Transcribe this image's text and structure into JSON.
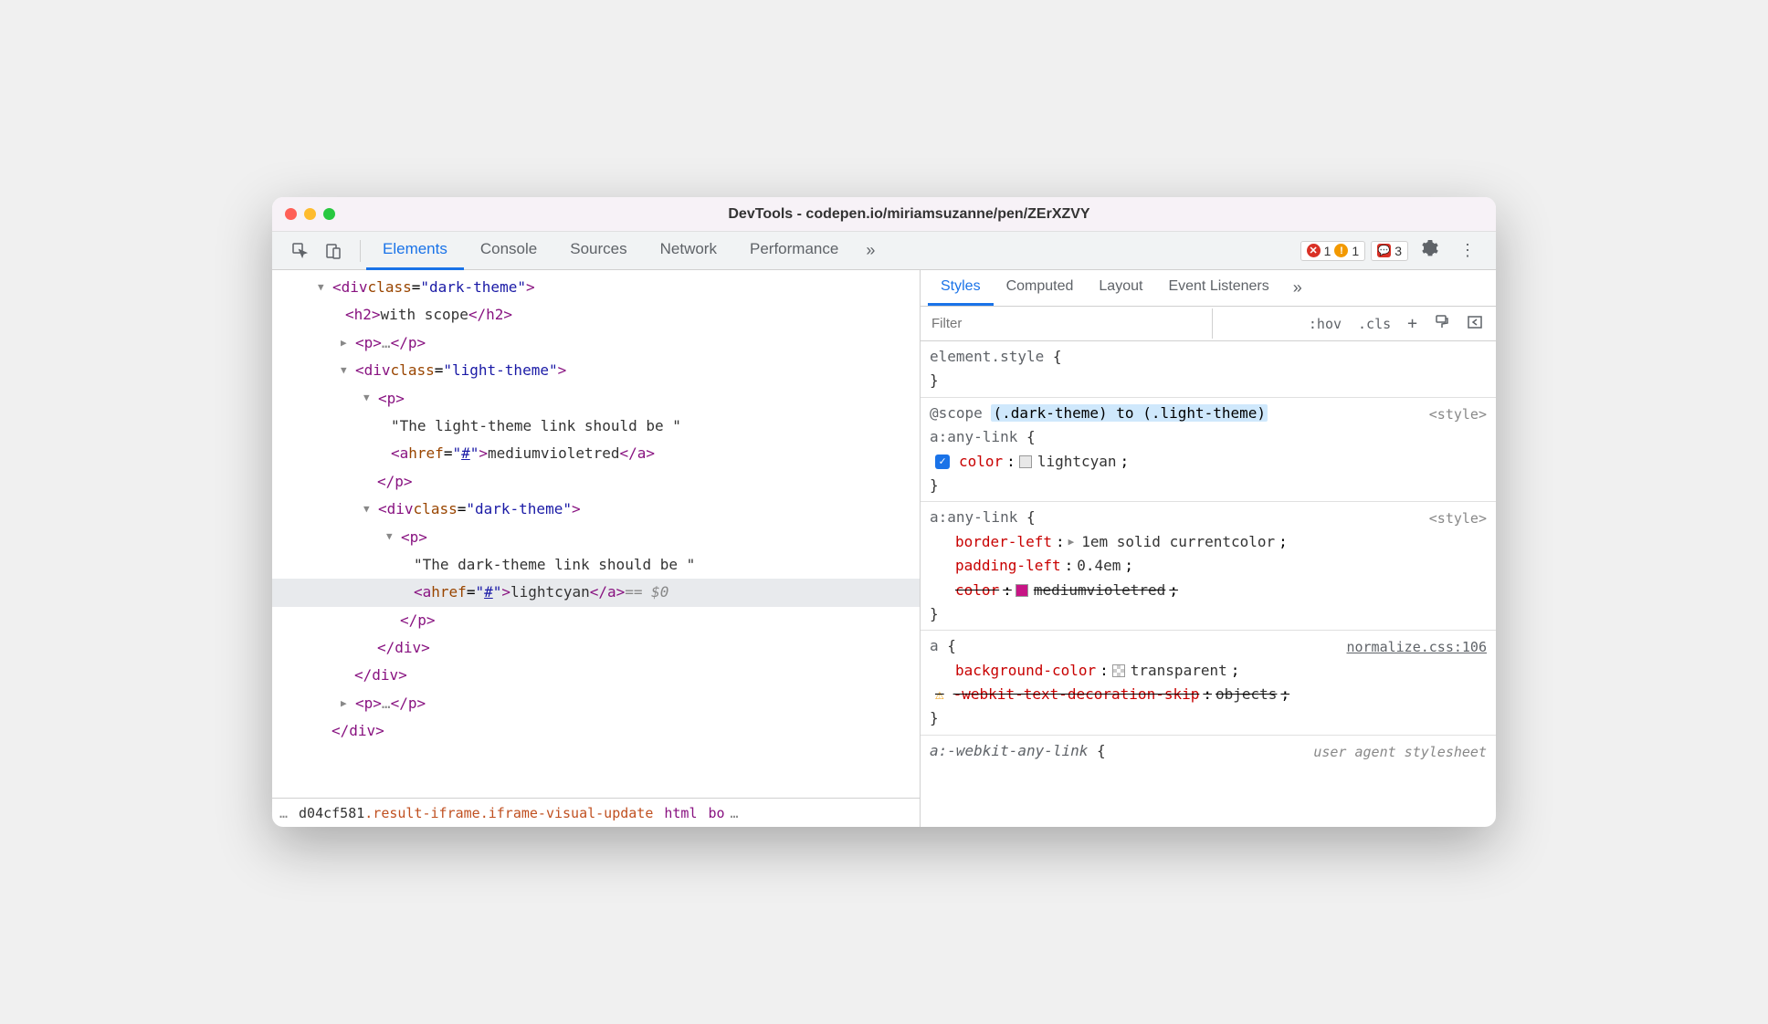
{
  "window_title": "DevTools - codepen.io/miriamsuzanne/pen/ZErXZVY",
  "main_tabs": [
    "Elements",
    "Console",
    "Sources",
    "Network",
    "Performance"
  ],
  "main_tabs_more": "»",
  "badges": {
    "errors": "1",
    "warnings": "1",
    "issues": "3"
  },
  "dom": {
    "line1_class": "dark-theme",
    "line2_text": "with scope",
    "line3_ell": "…",
    "line4_class": "light-theme",
    "p1_text": "\"The light-theme link should be \"",
    "a1_href": "#",
    "a1_text": "mediumvioletred",
    "line_nested_dark_class": "dark-theme",
    "p2_text": "\"The dark-theme link should be \"",
    "a2_href": "#",
    "a2_text": "lightcyan",
    "selected_marker": "== $0"
  },
  "breadcrumb": {
    "ellipsis": "…",
    "frag1": "d04cf581",
    "frag2": ".result-iframe.iframe-visual-update",
    "frag3": "html",
    "frag4": "bo",
    "frag5": "…"
  },
  "styles_tabs": [
    "Styles",
    "Computed",
    "Layout",
    "Event Listeners"
  ],
  "styles_tabs_more": "»",
  "filter_placeholder": "Filter",
  "toolbar_btns": {
    "hov": ":hov",
    "cls": ".cls",
    "plus": "+"
  },
  "rules": {
    "element_style": "element.style",
    "scope_prefix": "@scope",
    "scope_range": "(.dark-theme) to (.light-theme)",
    "r1_selector": "a:any-link",
    "r1_source": "<style>",
    "r1_prop": "color",
    "r1_val": "lightcyan",
    "r2_selector": "a:any-link",
    "r2_source": "<style>",
    "r2_p1": "border-left",
    "r2_v1": "1em solid currentcolor",
    "r2_p2": "padding-left",
    "r2_v2": "0.4em",
    "r2_p3": "color",
    "r2_v3": "mediumvioletred",
    "r3_selector": "a",
    "r3_source": "normalize.css:106",
    "r3_p1": "background-color",
    "r3_v1": "transparent",
    "r3_p2": "-webkit-text-decoration-skip",
    "r3_v2": "objects",
    "r4_selector": "a:-webkit-any-link",
    "r4_source": "user agent stylesheet"
  }
}
